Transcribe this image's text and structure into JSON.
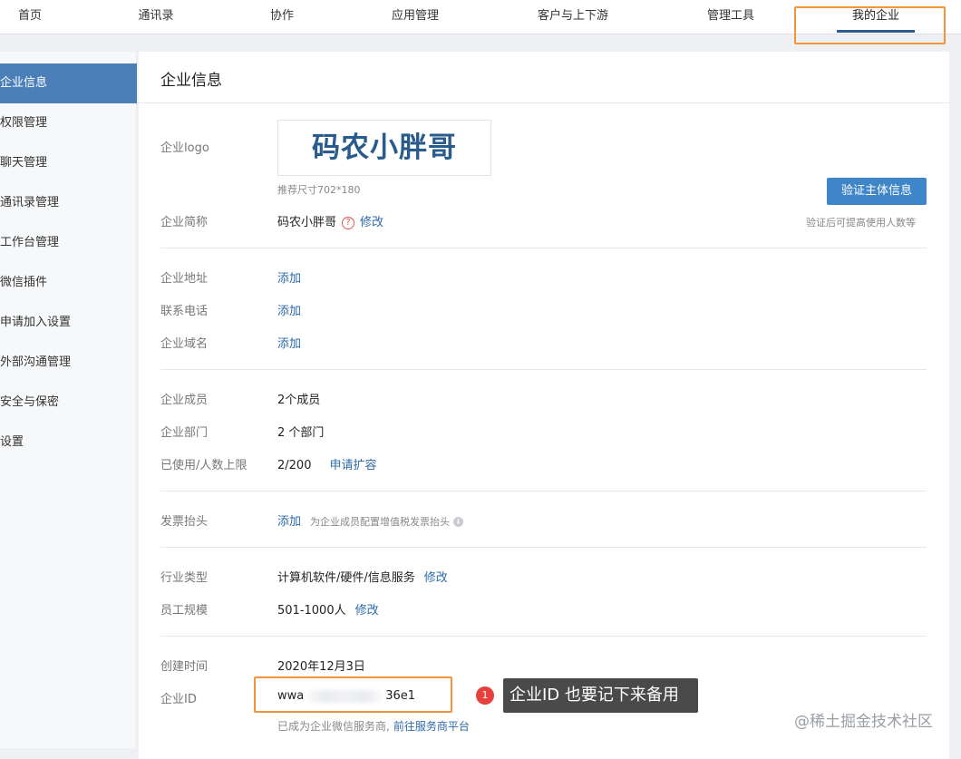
{
  "nav": {
    "tabs": [
      "首页",
      "通讯录",
      "协作",
      "应用管理",
      "客户与上下游",
      "管理工具",
      "我的企业"
    ],
    "active": "我的企业"
  },
  "sidebar": {
    "items": [
      "企业信息",
      "权限管理",
      "聊天管理",
      "通讯录管理",
      "工作台管理",
      "微信插件",
      "申请加入设置",
      "外部沟通管理",
      "安全与保密",
      "设置"
    ],
    "active": "企业信息"
  },
  "page": {
    "title": "企业信息",
    "logo_label": "企业logo",
    "logo_text": "码农小胖哥",
    "logo_hint": "推荐尺寸702*180",
    "verify_button": "验证主体信息",
    "verify_hint": "验证后可提高使用人数等",
    "short_name_label": "企业简称",
    "short_name": "码农小胖哥",
    "short_name_edit": "修改",
    "address_label": "企业地址",
    "address_action": "添加",
    "phone_label": "联系电话",
    "phone_action": "添加",
    "domain_label": "企业域名",
    "domain_action": "添加",
    "members_label": "企业成员",
    "members": "2个成员",
    "depts_label": "企业部门",
    "depts": "2 个部门",
    "usage_label": "已使用/人数上限",
    "usage": "2/200",
    "usage_action": "申请扩容",
    "invoice_label": "发票抬头",
    "invoice_action": "添加",
    "invoice_hint": "为企业成员配置增值税发票抬头",
    "industry_label": "行业类型",
    "industry": "计算机软件/硬件/信息服务",
    "industry_edit": "修改",
    "scale_label": "员工规模",
    "scale": "501-1000人",
    "scale_edit": "修改",
    "created_label": "创建时间",
    "created": "2020年12月3日",
    "corpid_label": "企业ID",
    "corpid_prefix": "wwa",
    "corpid_suffix": "36e1",
    "provider_text": "已成为企业微信服务商,",
    "provider_link": "前往服务商平台"
  },
  "annotation": {
    "badge": "1",
    "callout": "企业ID 也要记下来备用"
  },
  "watermark": "@稀土掘金技术社区",
  "colors": {
    "accent": "#4a7fb8",
    "link": "#2d6aa8",
    "highlight": "#f0953a",
    "badge": "#e8403d"
  }
}
